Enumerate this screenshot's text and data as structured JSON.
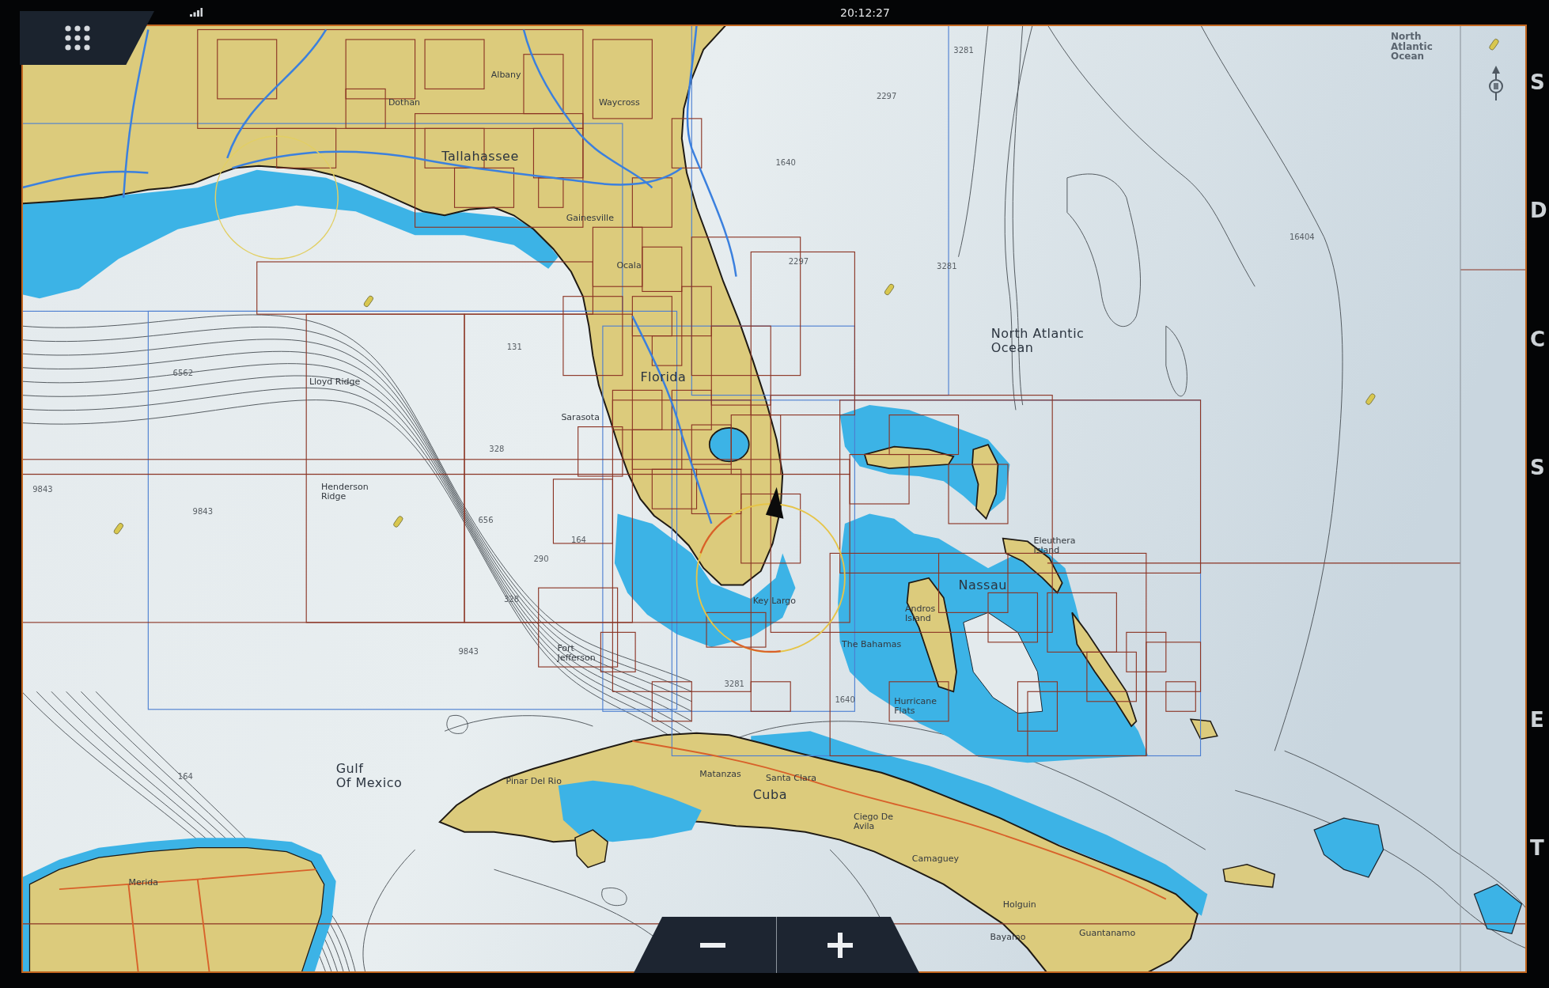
{
  "status_bar": {
    "time": "20:12:27"
  },
  "chart": {
    "corner_label": {
      "lines": [
        "North",
        "Atlantic",
        "Ocean"
      ]
    },
    "place_labels": [
      {
        "kind": "major",
        "lines": [
          "Tallahassee"
        ]
      },
      {
        "kind": "major",
        "lines": [
          "Florida"
        ]
      },
      {
        "kind": "major",
        "lines": [
          "North Atlantic",
          "Ocean"
        ]
      },
      {
        "kind": "major",
        "lines": [
          "Nassau"
        ]
      },
      {
        "kind": "major",
        "lines": [
          "Cuba"
        ]
      },
      {
        "kind": "major",
        "lines": [
          "Gulf",
          "Of Mexico"
        ]
      },
      {
        "kind": "minor",
        "lines": [
          "Dothan"
        ]
      },
      {
        "kind": "minor",
        "lines": [
          "Albany"
        ]
      },
      {
        "kind": "minor",
        "lines": [
          "Waycross"
        ]
      },
      {
        "kind": "minor",
        "lines": [
          "Gainesville"
        ]
      },
      {
        "kind": "minor",
        "lines": [
          "Ocala"
        ]
      },
      {
        "kind": "minor",
        "lines": [
          "Sarasota"
        ]
      },
      {
        "kind": "minor",
        "lines": [
          "Lloyd Ridge"
        ]
      },
      {
        "kind": "minor",
        "lines": [
          "Henderson",
          "Ridge"
        ]
      },
      {
        "kind": "minor",
        "lines": [
          "Fort",
          "Jefferson"
        ]
      },
      {
        "kind": "minor",
        "lines": [
          "Key Largo"
        ]
      },
      {
        "kind": "minor",
        "lines": [
          "The Bahamas"
        ]
      },
      {
        "kind": "minor",
        "lines": [
          "Andros",
          "Island"
        ]
      },
      {
        "kind": "minor",
        "lines": [
          "Hurricane",
          "Flats"
        ]
      },
      {
        "kind": "minor",
        "lines": [
          "Eleuthera",
          "Island"
        ]
      },
      {
        "kind": "minor",
        "lines": [
          "Pinar Del Rio"
        ]
      },
      {
        "kind": "minor",
        "lines": [
          "Matanzas"
        ]
      },
      {
        "kind": "minor",
        "lines": [
          "Santa Clara"
        ]
      },
      {
        "kind": "minor",
        "lines": [
          "Ciego De",
          "Avila"
        ]
      },
      {
        "kind": "minor",
        "lines": [
          "Camaguey"
        ]
      },
      {
        "kind": "minor",
        "lines": [
          "Holguin"
        ]
      },
      {
        "kind": "minor",
        "lines": [
          "Bayamo"
        ]
      },
      {
        "kind": "minor",
        "lines": [
          "Guantanamo"
        ]
      },
      {
        "kind": "minor",
        "lines": [
          "Merida"
        ]
      }
    ],
    "depth_soundings": [
      "3281",
      "2297",
      "1640",
      "2297",
      "3281",
      "16404",
      "131",
      "328",
      "656",
      "164",
      "290",
      "328",
      "9843",
      "6562",
      "9843",
      "9843",
      "3281",
      "1640",
      "164"
    ]
  },
  "side_menu": {
    "items": [
      {
        "label": "S"
      },
      {
        "label": "D"
      },
      {
        "label": "C"
      },
      {
        "label": "S"
      },
      {
        "label": "E"
      },
      {
        "label": "T"
      }
    ]
  }
}
